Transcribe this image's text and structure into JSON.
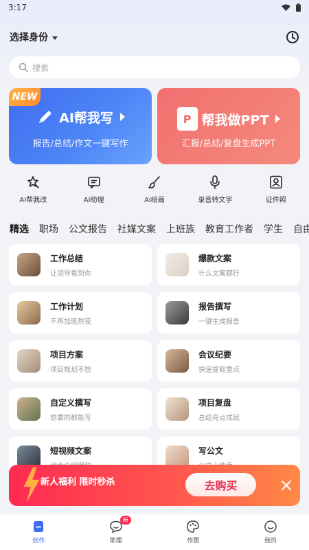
{
  "status": {
    "time": "3:17"
  },
  "header": {
    "identity_label": "选择身份"
  },
  "search": {
    "placeholder": "搜索"
  },
  "banners": [
    {
      "badge": "NEW",
      "title": "AI帮我写",
      "subtitle": "报告/总结/作文一键写作",
      "color": "#4f87f7"
    },
    {
      "title": "帮我做PPT",
      "subtitle": "汇报/总结/复盘生成PPT",
      "color": "#f27070"
    }
  ],
  "tools": [
    {
      "label": "AI帮我改",
      "icon": "magic-icon"
    },
    {
      "label": "AI助理",
      "icon": "chat-icon"
    },
    {
      "label": "AI绘画",
      "icon": "brush-icon"
    },
    {
      "label": "录音转文字",
      "icon": "microphone-icon"
    },
    {
      "label": "证件照",
      "icon": "id-photo-icon"
    }
  ],
  "tabs": [
    "精选",
    "职场",
    "公文报告",
    "社媒文案",
    "上班族",
    "教育工作者",
    "学生",
    "自由"
  ],
  "cards": [
    {
      "title": "工作总结",
      "subtitle": "让领导看到你"
    },
    {
      "title": "爆款文案",
      "subtitle": "什么文案都行"
    },
    {
      "title": "工作计划",
      "subtitle": "不再加班熬夜"
    },
    {
      "title": "报告撰写",
      "subtitle": "一键生成报告"
    },
    {
      "title": "项目方案",
      "subtitle": "项目规划不愁"
    },
    {
      "title": "会议纪要",
      "subtitle": "快速提取重点"
    },
    {
      "title": "自定义撰写",
      "subtitle": "想要的都能写"
    },
    {
      "title": "项目复盘",
      "subtitle": "总结亮点成就"
    },
    {
      "title": "短视频文案",
      "subtitle": "综合全网爆款"
    },
    {
      "title": "写公文",
      "subtitle": "公文小助手"
    }
  ],
  "promo": {
    "text": "新人福利 限时秒杀",
    "button": "去购买"
  },
  "nav": [
    {
      "label": "创作",
      "icon": "create-icon"
    },
    {
      "label": "助理",
      "icon": "assistant-icon",
      "badge": "新"
    },
    {
      "label": "作图",
      "icon": "palette-icon"
    },
    {
      "label": "我的",
      "icon": "profile-icon"
    }
  ],
  "colors": {
    "accent": "#3d6ef2",
    "promo": "#ff2a52"
  }
}
